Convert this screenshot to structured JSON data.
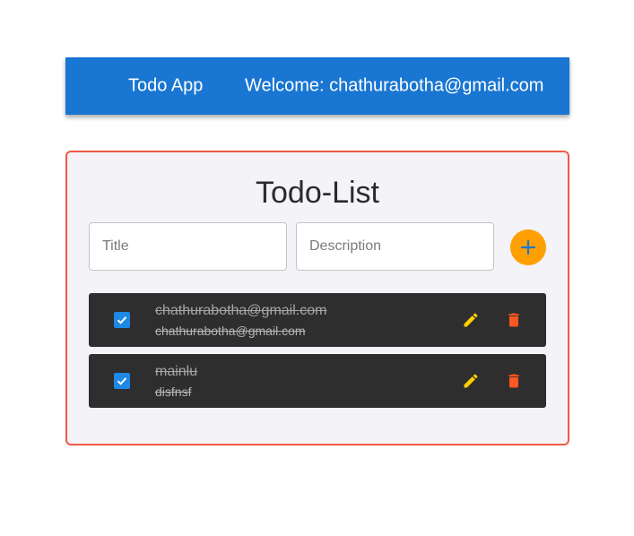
{
  "header": {
    "app_title": "Todo App",
    "welcome_text": "Welcome: chathurabotha@gmail.com"
  },
  "todo_card": {
    "heading": "Todo-List",
    "title_input": {
      "placeholder": "Title",
      "value": ""
    },
    "description_input": {
      "placeholder": "Description",
      "value": ""
    },
    "add_button_icon": "plus-icon",
    "items": [
      {
        "title": "chathurabotha@gmail.com",
        "description": "chathurabotha@gmail.com",
        "completed": true
      },
      {
        "title": "mainlu",
        "description": "disfnsf",
        "completed": true
      }
    ]
  },
  "colors": {
    "appbar": "#1976d2",
    "card_border": "#ef5a45",
    "add_button": "#ffa000",
    "row_background": "#2e2e2e",
    "checkbox": "#1e88e5",
    "edit_icon": "#ffd000",
    "delete_icon": "#ff5722"
  },
  "icons": {
    "edit": "pencil-icon",
    "delete": "trash-icon",
    "checkbox": "checkmark-icon"
  }
}
